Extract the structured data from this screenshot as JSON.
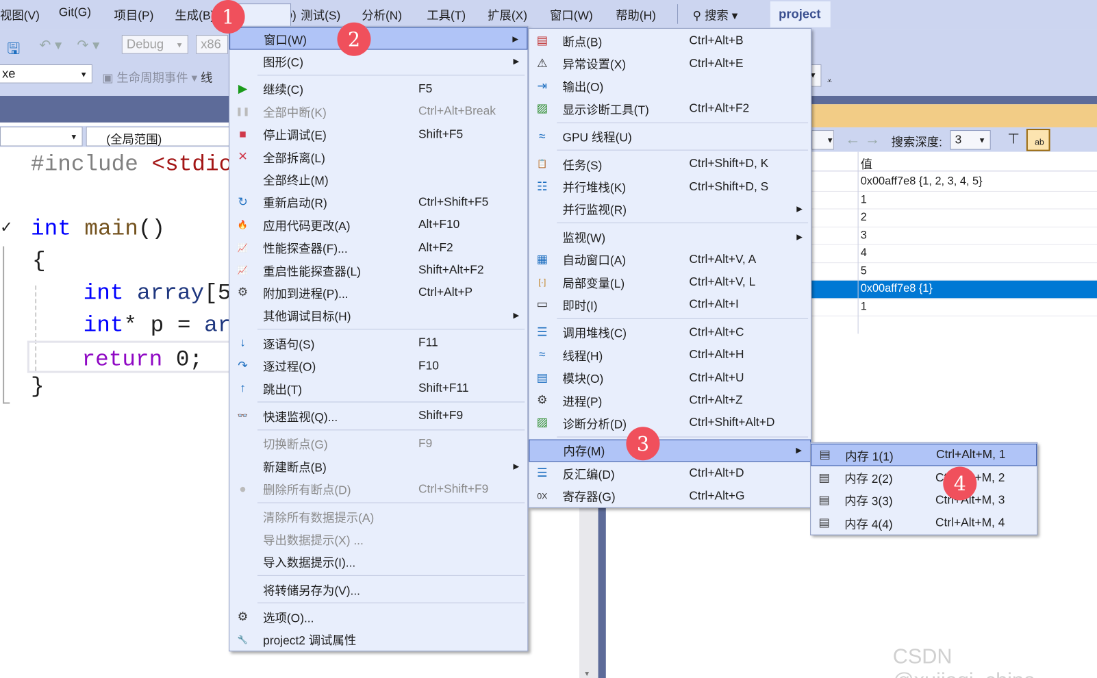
{
  "menubar": {
    "items": [
      "视图(V)",
      "Git(G)",
      "项目(P)",
      "生成(B)",
      "调试(D)",
      "测试(S)",
      "分析(N)",
      "工具(T)",
      "扩展(X)",
      "窗口(W)",
      "帮助(H)"
    ],
    "search": "搜索",
    "project": "project"
  },
  "toolbar": {
    "config": "Debug",
    "platform": "x86",
    "exe": "xe",
    "lifecycle": "生命周期事件",
    "thread": "线",
    "scope": "(全局范围)"
  },
  "code": {
    "line1a": "#include ",
    "line1b": "<stdio.",
    "line2a": "int",
    "line2b": " main",
    "line2c": "()",
    "brace_open": "{",
    "line3a": "int",
    "line3b": " array",
    "line3c": "[5",
    "line4a": "int",
    "line4b": "* p = ",
    "line4c": "ar",
    "line5a": "return",
    "line5b": " 0;  ",
    "line5c": "⊟",
    "brace_close": "}",
    "check": "✓"
  },
  "watch": {
    "search_depth_label": "搜索深度:",
    "search_depth": "3",
    "value_header": "值",
    "rows": [
      "0x00aff7e8 {1, 2, 3, 4, 5}",
      "1",
      "2",
      "3",
      "4",
      "5",
      "0x00aff7e8 {1}",
      "1"
    ],
    "selected_row": 6
  },
  "debug_menu": [
    {
      "label": "窗口(W)",
      "submenu": true,
      "highlight": true
    },
    {
      "label": "图形(C)",
      "submenu": true
    },
    {
      "sep": true
    },
    {
      "icon": "play-icon",
      "label": "继续(C)",
      "shortcut": "F5"
    },
    {
      "icon": "pause-icon",
      "label": "全部中断(K)",
      "shortcut": "Ctrl+Alt+Break",
      "disabled": true
    },
    {
      "icon": "stop-icon",
      "label": "停止调试(E)",
      "shortcut": "Shift+F5"
    },
    {
      "icon": "detach-icon",
      "label": "全部拆离(L)"
    },
    {
      "label": "全部终止(M)"
    },
    {
      "icon": "restart-icon",
      "label": "重新启动(R)",
      "shortcut": "Ctrl+Shift+F5"
    },
    {
      "icon": "hot-reload-icon",
      "label": "应用代码更改(A)",
      "shortcut": "Alt+F10"
    },
    {
      "icon": "profiler-icon",
      "label": "性能探查器(F)...",
      "shortcut": "Alt+F2"
    },
    {
      "icon": "profiler-icon",
      "label": "重启性能探查器(L)",
      "shortcut": "Shift+Alt+F2"
    },
    {
      "icon": "attach-process-icon",
      "label": "附加到进程(P)...",
      "shortcut": "Ctrl+Alt+P"
    },
    {
      "label": "其他调试目标(H)",
      "submenu": true
    },
    {
      "sep": true
    },
    {
      "icon": "step-into-icon",
      "label": "逐语句(S)",
      "shortcut": "F11"
    },
    {
      "icon": "step-over-icon",
      "label": "逐过程(O)",
      "shortcut": "F10"
    },
    {
      "icon": "step-out-icon",
      "label": "跳出(T)",
      "shortcut": "Shift+F11"
    },
    {
      "sep": true
    },
    {
      "icon": "quickwatch-icon",
      "label": "快速监视(Q)...",
      "shortcut": "Shift+F9"
    },
    {
      "sep": true
    },
    {
      "label": "切换断点(G)",
      "shortcut": "F9",
      "disabled": true
    },
    {
      "label": "新建断点(B)",
      "submenu": true
    },
    {
      "icon": "delete-breakpoints-icon",
      "label": "删除所有断点(D)",
      "shortcut": "Ctrl+Shift+F9",
      "disabled": true
    },
    {
      "sep": true
    },
    {
      "label": "清除所有数据提示(A)",
      "disabled": true
    },
    {
      "label": "导出数据提示(X) ...",
      "disabled": true
    },
    {
      "label": "导入数据提示(I)..."
    },
    {
      "sep": true
    },
    {
      "label": "将转储另存为(V)..."
    },
    {
      "sep": true
    },
    {
      "icon": "gear-icon",
      "label": "选项(O)..."
    },
    {
      "icon": "wrench-icon",
      "label": "project2 调试属性"
    }
  ],
  "window_menu": [
    {
      "icon": "breakpoints-icon",
      "label": "断点(B)",
      "shortcut": "Ctrl+Alt+B"
    },
    {
      "icon": "exception-settings-icon",
      "label": "异常设置(X)",
      "shortcut": "Ctrl+Alt+E"
    },
    {
      "icon": "output-icon",
      "label": "输出(O)"
    },
    {
      "icon": "diagnostic-tools-icon",
      "label": "显示诊断工具(T)",
      "shortcut": "Ctrl+Alt+F2"
    },
    {
      "sep": true
    },
    {
      "icon": "gpu-threads-icon",
      "label": "GPU 线程(U)"
    },
    {
      "sep": true
    },
    {
      "icon": "tasks-icon",
      "label": "任务(S)",
      "shortcut": "Ctrl+Shift+D, K"
    },
    {
      "icon": "parallel-stacks-icon",
      "label": "并行堆栈(K)",
      "shortcut": "Ctrl+Shift+D, S"
    },
    {
      "label": "并行监视(R)",
      "submenu": true
    },
    {
      "sep": true
    },
    {
      "label": "监视(W)",
      "submenu": true
    },
    {
      "icon": "autos-icon",
      "label": "自动窗口(A)",
      "shortcut": "Ctrl+Alt+V, A"
    },
    {
      "icon": "locals-icon",
      "label": "局部变量(L)",
      "shortcut": "Ctrl+Alt+V, L"
    },
    {
      "icon": "immediate-icon",
      "label": "即时(I)",
      "shortcut": "Ctrl+Alt+I"
    },
    {
      "sep": true
    },
    {
      "icon": "call-stack-icon",
      "label": "调用堆栈(C)",
      "shortcut": "Ctrl+Alt+C"
    },
    {
      "icon": "threads-icon",
      "label": "线程(H)",
      "shortcut": "Ctrl+Alt+H"
    },
    {
      "icon": "modules-icon",
      "label": "模块(O)",
      "shortcut": "Ctrl+Alt+U"
    },
    {
      "icon": "processes-icon",
      "label": "进程(P)",
      "shortcut": "Ctrl+Alt+Z"
    },
    {
      "icon": "diagnostic-analysis-icon",
      "label": "诊断分析(D)",
      "shortcut": "Ctrl+Shift+Alt+D"
    },
    {
      "sep": true
    },
    {
      "label": "内存(M)",
      "submenu": true,
      "highlight": true
    },
    {
      "icon": "disassembly-icon",
      "label": "反汇编(D)",
      "shortcut": "Ctrl+Alt+D"
    },
    {
      "icon": "registers-icon",
      "label": "寄存器(G)",
      "shortcut": "Ctrl+Alt+G"
    }
  ],
  "memory_menu": [
    {
      "icon": "memory-icon",
      "label": "内存 1(1)",
      "shortcut": "Ctrl+Alt+M, 1",
      "highlight": true
    },
    {
      "icon": "memory-icon",
      "label": "内存 2(2)",
      "shortcut": "Ctrl+Alt+M, 2"
    },
    {
      "icon": "memory-icon",
      "label": "内存 3(3)",
      "shortcut": "Ctrl+Alt+M, 3"
    },
    {
      "icon": "memory-icon",
      "label": "内存 4(4)",
      "shortcut": "Ctrl+Alt+M, 4"
    }
  ],
  "badges": [
    "1",
    "2",
    "3",
    "4"
  ],
  "watermark": "CSDN @xujiaqi_china",
  "colors": {
    "menu_bg": "#e8eefc",
    "highlight": "#b0c4f7",
    "selected_row": "#0078d4",
    "badge": "#f0505c",
    "title_strip": "#5d6b99",
    "warning_bar": "#f2cc86"
  }
}
